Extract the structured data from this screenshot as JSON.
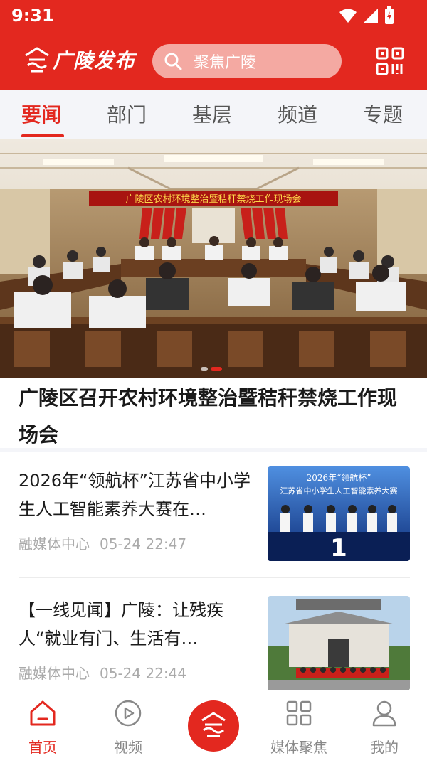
{
  "status_bar": {
    "time": "9:31"
  },
  "app_bar": {
    "brand": "广陵发布",
    "search_placeholder": "聚焦广陵"
  },
  "tabs": [
    {
      "label": "要闻",
      "active": true
    },
    {
      "label": "部门",
      "active": false
    },
    {
      "label": "基层",
      "active": false
    },
    {
      "label": "频道",
      "active": false
    },
    {
      "label": "专题",
      "active": false
    }
  ],
  "hero": {
    "banner_text": "广陵区农村环境整治暨秸秆禁烧工作现场会",
    "title": "广陵区召开农村环境整治暨秸秆禁烧工作现场会",
    "slide_count": 2,
    "active_slide": 1
  },
  "news": [
    {
      "title": "2026年“领航杯”江苏省中小学生人工智能素养大赛在…",
      "source": "融媒体中心",
      "time": "05-24 22:47",
      "thumb_text_1": "2026年“领航杯”",
      "thumb_text_2": "江苏省中小学生人工智能素养大赛"
    },
    {
      "title": "【一线见闻】广陵：让残疾人“就业有门、生活有…",
      "source": "融媒体中心",
      "time": "05-24 22:44"
    }
  ],
  "bottom_nav": [
    {
      "label": "首页",
      "icon": "home-icon",
      "active": true
    },
    {
      "label": "视频",
      "icon": "play-icon",
      "active": false
    },
    {
      "label": "",
      "icon": "logo-icon",
      "active": false
    },
    {
      "label": "媒体聚焦",
      "icon": "grid-icon",
      "active": false
    },
    {
      "label": "我的",
      "icon": "user-icon",
      "active": false
    }
  ],
  "colors": {
    "brand_red": "#e3281f",
    "tab_bg": "#f4f5f9"
  }
}
